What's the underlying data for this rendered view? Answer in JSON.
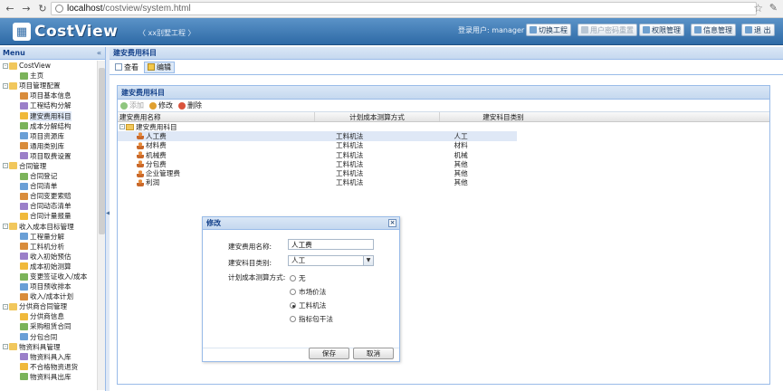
{
  "browser": {
    "url_host": "localhost",
    "url_path": "/costview/system.html"
  },
  "header": {
    "app_logo_text": "CostView",
    "project_name": "〈 xx别墅工程 〉",
    "login_user": "登录用户: manager",
    "buttons": [
      {
        "label": "切换工程",
        "enabled": true
      },
      {
        "label": "用户密码重置",
        "enabled": false
      },
      {
        "label": "权限管理",
        "enabled": true
      },
      {
        "label": "信息管理",
        "enabled": true
      },
      {
        "label": "退 出",
        "enabled": true
      }
    ]
  },
  "sidebar": {
    "title": "Menu",
    "collapse_glyph": "«",
    "items": [
      {
        "label": "CostView",
        "level": 0,
        "expander": "-"
      },
      {
        "label": "主页",
        "level": 1
      },
      {
        "label": "项目管理配置",
        "level": 0,
        "expander": "-"
      },
      {
        "label": "项目基本信息",
        "level": 1
      },
      {
        "label": "工程结构分解",
        "level": 1
      },
      {
        "label": "建安费用科目",
        "level": 1,
        "selected": true
      },
      {
        "label": "成本分解结构",
        "level": 1
      },
      {
        "label": "项目资源库",
        "level": 1
      },
      {
        "label": "通用类别库",
        "level": 1
      },
      {
        "label": "项目取费设置",
        "level": 1
      },
      {
        "label": "合同管理",
        "level": 0,
        "expander": "-"
      },
      {
        "label": "合同登记",
        "level": 1
      },
      {
        "label": "合同清单",
        "level": 1
      },
      {
        "label": "合同变更索赔",
        "level": 1
      },
      {
        "label": "合同动态清单",
        "level": 1
      },
      {
        "label": "合同计量报量",
        "level": 1
      },
      {
        "label": "收入成本目标管理",
        "level": 0,
        "expander": "-"
      },
      {
        "label": "工程量分解",
        "level": 1
      },
      {
        "label": "工料机分析",
        "level": 1
      },
      {
        "label": "收入初始预估",
        "level": 1
      },
      {
        "label": "成本初始测算",
        "level": 1
      },
      {
        "label": "变更签证收入/成本",
        "level": 1
      },
      {
        "label": "项目预收排本",
        "level": 1
      },
      {
        "label": "收入/成本计划",
        "level": 1
      },
      {
        "label": "分供商合同管理",
        "level": 0,
        "expander": "-"
      },
      {
        "label": "分供商信息",
        "level": 1
      },
      {
        "label": "采购租赁合同",
        "level": 1
      },
      {
        "label": "分包合同",
        "level": 1
      },
      {
        "label": "物资料具管理",
        "level": 0,
        "expander": "-"
      },
      {
        "label": "物资料具入库",
        "level": 1
      },
      {
        "label": "不合格物资退货",
        "level": 1
      },
      {
        "label": "物资料具出库",
        "level": 1
      }
    ]
  },
  "main": {
    "title": "建安费用科目",
    "tabs": [
      {
        "label": "查看",
        "active": false
      },
      {
        "label": "编辑",
        "active": true
      }
    ],
    "inner_title": "建安费用科目",
    "toolbar": [
      {
        "label": "添加",
        "enabled": false,
        "icon": "add-icon",
        "color": "#5aa84a"
      },
      {
        "label": "修改",
        "enabled": true,
        "icon": "edit-icon",
        "color": "#e0a030"
      },
      {
        "label": "删除",
        "enabled": true,
        "icon": "delete-icon",
        "color": "#d9533c"
      }
    ],
    "columns": [
      "建安费用名称",
      "计划成本测算方式",
      "建安科目类别"
    ],
    "root": {
      "name": "建安费用科目"
    },
    "rows": [
      {
        "name": "人工费",
        "method": "工料机法",
        "category": "人工",
        "selected": true
      },
      {
        "name": "材料费",
        "method": "工料机法",
        "category": "材料"
      },
      {
        "name": "机械费",
        "method": "工料机法",
        "category": "机械"
      },
      {
        "name": "分包费",
        "method": "工料机法",
        "category": "其他"
      },
      {
        "name": "企业管理费",
        "method": "工料机法",
        "category": "其他"
      },
      {
        "name": "利润",
        "method": "工料机法",
        "category": "其他"
      }
    ]
  },
  "dialog": {
    "title": "修改",
    "close_glyph": "×",
    "name_label": "建安费用名称:",
    "name_value": "人工费",
    "category_label": "建安科目类别:",
    "category_value": "人工",
    "method_label": "计划成本测算方式:",
    "method_options": [
      {
        "label": "无",
        "checked": false
      },
      {
        "label": "市场价法",
        "checked": false
      },
      {
        "label": "工料机法",
        "checked": true
      },
      {
        "label": "指标包干法",
        "checked": false
      }
    ],
    "save_label": "保存",
    "cancel_label": "取消"
  },
  "colors": {
    "header_blue": "#2e6aa6",
    "panel_title_text": "#15428b",
    "panel_border": "#99bbe8",
    "selection": "#dfe8f6"
  }
}
